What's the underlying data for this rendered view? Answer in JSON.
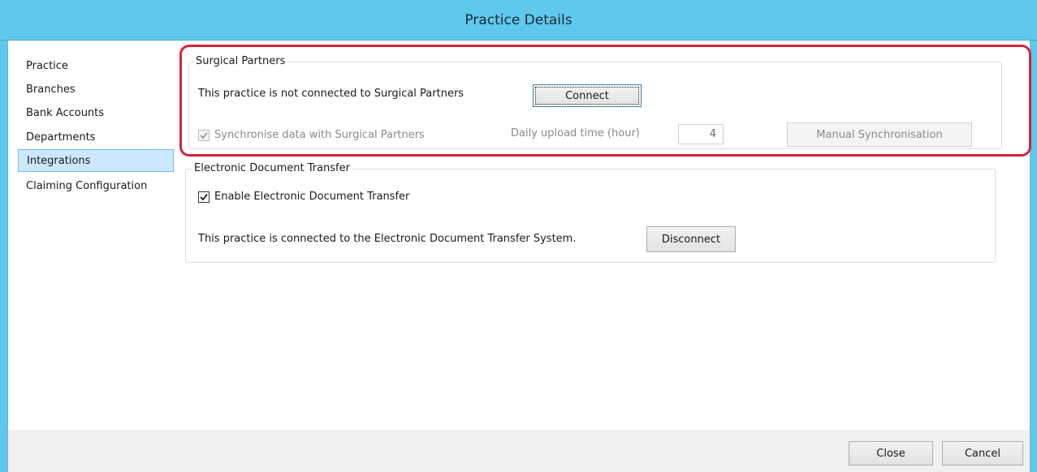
{
  "window": {
    "title": "Practice Details",
    "accent_color": "#5ec9ec",
    "highlight_color": "#d6213b"
  },
  "sidebar": {
    "items": [
      {
        "label": "Practice"
      },
      {
        "label": "Branches"
      },
      {
        "label": "Bank Accounts"
      },
      {
        "label": "Departments"
      },
      {
        "label": "Integrations",
        "selected": true
      },
      {
        "label": "Claiming Configuration"
      }
    ]
  },
  "surgical_partners": {
    "title": "Surgical Partners",
    "status_text": "This practice is not connected to Surgical Partners",
    "connect_label": "Connect",
    "sync_label": "Synchronise data with Surgical Partners",
    "sync_checked": true,
    "sync_enabled": false,
    "upload_time_label": "Daily upload time (hour)",
    "upload_time_value": "4",
    "manual_sync_label": "Manual Synchronisation"
  },
  "edt": {
    "title": "Electronic Document Transfer",
    "enable_label": "Enable Electronic Document Transfer",
    "enable_checked": true,
    "status_text": "This practice is connected to the Electronic Document Transfer System.",
    "disconnect_label": "Disconnect"
  },
  "footer": {
    "close_label": "Close",
    "cancel_label": "Cancel"
  },
  "icons": {
    "checkmark": "checkmark-icon"
  }
}
